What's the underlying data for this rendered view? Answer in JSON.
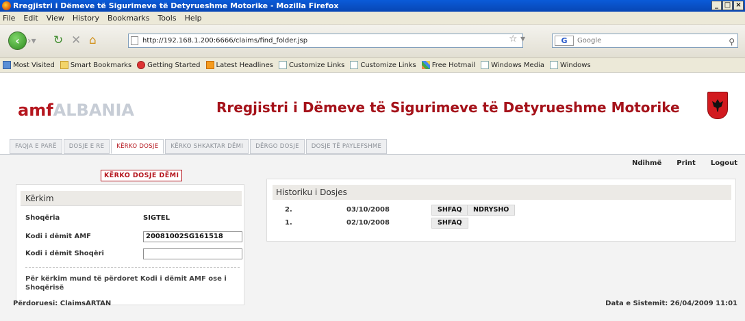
{
  "window": {
    "title": "Rregjistri i Dëmeve të Sigurimeve të Detyrueshme Motorike - Mozilla Firefox",
    "buttons": [
      "_",
      "□",
      "×"
    ]
  },
  "menu": [
    "File",
    "Edit",
    "View",
    "History",
    "Bookmarks",
    "Tools",
    "Help"
  ],
  "navbar": {
    "url": "http://192.168.1.200:6666/claims/find_folder.jsp",
    "search_placeholder": "Google",
    "search_engine": "G"
  },
  "bookmarks": [
    {
      "label": "Most Visited",
      "icon": "blue"
    },
    {
      "label": "Smart Bookmarks",
      "icon": "folder"
    },
    {
      "label": "Getting Started",
      "icon": "red"
    },
    {
      "label": "Latest Headlines",
      "icon": "rss"
    },
    {
      "label": "Customize Links",
      "icon": "page"
    },
    {
      "label": "Customize Links",
      "icon": "page"
    },
    {
      "label": "Free Hotmail",
      "icon": "ms"
    },
    {
      "label": "Windows Media",
      "icon": "page"
    },
    {
      "label": "Windows",
      "icon": "page"
    }
  ],
  "site": {
    "logo_amf": "amf",
    "logo_albania": "ALBANIA",
    "title": "Rregjistri i Dëmeve të Sigurimeve të Detyrueshme Motorike"
  },
  "tabs": [
    {
      "label": "FAQJA E PARË",
      "active": false
    },
    {
      "label": "DOSJE E RE",
      "active": false
    },
    {
      "label": "KËRKO DOSJE",
      "active": true
    },
    {
      "label": "KËRKO SHKAKTAR DËMI",
      "active": false
    },
    {
      "label": "DËRGO DOSJE",
      "active": false
    },
    {
      "label": "DOSJE TË PAYLEFSHME",
      "active": false
    }
  ],
  "toplinks": {
    "help": "Ndihmë",
    "print": "Print",
    "logout": "Logout"
  },
  "search": {
    "section_title": "KËRKO DOSJE DËMI",
    "panel_title": "Kërkim",
    "company_label": "Shoqëria",
    "company_value": "SIGTEL",
    "amf_code_label": "Kodi i dëmit AMF",
    "amf_code_value": "20081002SG161518",
    "company_code_label": "Kodi i dëmit Shoqëri",
    "company_code_value": "",
    "note": "Për kërkim mund të përdoret Kodi i dëmit AMF ose i Shoqërisë"
  },
  "history": {
    "title": "Historiku i Dosjes",
    "rows": [
      {
        "num": "2.",
        "date": "03/10/2008",
        "show": "SHFAQ",
        "edit": "NDRYSHO"
      },
      {
        "num": "1.",
        "date": "02/10/2008",
        "show": "SHFAQ",
        "edit": ""
      }
    ]
  },
  "footer": {
    "user": "Përdoruesi: ClaimsARTAN",
    "system_date": "Data e Sistemit: 26/04/2009 11:01"
  },
  "colors": {
    "brand_red": "#b5161e",
    "xp_blue": "#0a5bd8"
  }
}
